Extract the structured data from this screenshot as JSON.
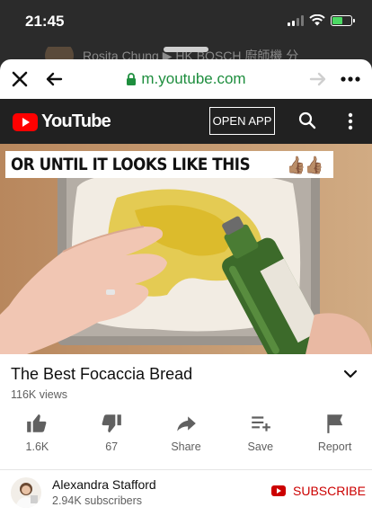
{
  "status_bar": {
    "time": "21:45"
  },
  "background_text": "Rosita Chung ▶ HK BOSCH 廚師機 分",
  "browser": {
    "url": "m.youtube.com"
  },
  "youtube_header": {
    "logo_text": "YouTube",
    "open_app_label": "OPEN APP"
  },
  "video": {
    "caption_text": "OR UNTIL IT LOOKS LIKE THIS",
    "caption_emoji": "👍🏽👍🏽"
  },
  "title": {
    "text": "The Best Focaccia Bread",
    "views": "116K views"
  },
  "actions": [
    {
      "icon": "thumbs-up-icon",
      "label": "1.6K"
    },
    {
      "icon": "thumbs-down-icon",
      "label": "67"
    },
    {
      "icon": "share-icon",
      "label": "Share"
    },
    {
      "icon": "save-playlist-icon",
      "label": "Save"
    },
    {
      "icon": "flag-icon",
      "label": "Report"
    }
  ],
  "channel": {
    "name": "Alexandra Stafford",
    "subscribers": "2.94K subscribers",
    "subscribe_label": "SUBSCRIBE"
  },
  "colors": {
    "brand_red": "#ff0000",
    "subscribe_red": "#cc0000",
    "url_green": "#1e8e3e",
    "header_bg": "#212121"
  }
}
